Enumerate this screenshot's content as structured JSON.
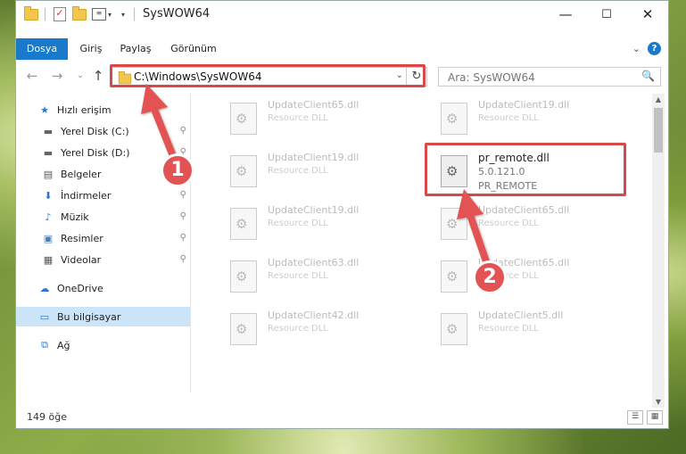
{
  "window": {
    "title": "SysWOW64",
    "minimize": "—",
    "maximize": "☐",
    "close": "✕"
  },
  "ribbon": {
    "tabs": [
      "Dosya",
      "Giriş",
      "Paylaş",
      "Görünüm"
    ],
    "expand": "⌄",
    "help": "?"
  },
  "address": {
    "path": "C:\\Windows\\SysWOW64",
    "refresh": "↻",
    "dropdown": "⌄"
  },
  "search": {
    "placeholder": "Ara: SysWOW64",
    "icon": "🔍"
  },
  "nav_buttons": {
    "back": "←",
    "forward": "→",
    "recent": "⌄",
    "up": "↑"
  },
  "sidebar": {
    "items": [
      {
        "label": "Hızlı erişim",
        "icon": "star-icon",
        "glyph": "★",
        "color": "#2a78d6",
        "pinned": false
      },
      {
        "label": "Yerel Disk (C:)",
        "icon": "drive-icon",
        "glyph": "▬",
        "color": "#666",
        "pinned": true
      },
      {
        "label": "Yerel Disk (D:)",
        "icon": "drive-icon",
        "glyph": "▬",
        "color": "#666",
        "pinned": true
      },
      {
        "label": "Belgeler",
        "icon": "documents-icon",
        "glyph": "▤",
        "color": "#555",
        "pinned": true
      },
      {
        "label": "İndirmeler",
        "icon": "download-icon",
        "glyph": "⬇",
        "color": "#2a78d6",
        "pinned": true
      },
      {
        "label": "Müzik",
        "icon": "music-icon",
        "glyph": "♪",
        "color": "#2a78d6",
        "pinned": true
      },
      {
        "label": "Resimler",
        "icon": "pictures-icon",
        "glyph": "▣",
        "color": "#4a7fb5",
        "pinned": true
      },
      {
        "label": "Videolar",
        "icon": "video-icon",
        "glyph": "▦",
        "color": "#555",
        "pinned": true
      },
      {
        "label": "OneDrive",
        "icon": "cloud-icon",
        "glyph": "☁",
        "color": "#2a78d6",
        "pinned": false
      },
      {
        "label": "Bu bilgisayar",
        "icon": "computer-icon",
        "glyph": "▭",
        "color": "#2a78d6",
        "pinned": false
      },
      {
        "label": "Ağ",
        "icon": "network-icon",
        "glyph": "⧉",
        "color": "#2a78d6",
        "pinned": false
      }
    ],
    "pin_glyph": "📌"
  },
  "files": [
    {
      "name": "UpdateClient65.dll",
      "type": "Resource DLL"
    },
    {
      "name": "UpdateClient19.dll",
      "type": "Resource DLL"
    },
    {
      "name": "UpdateClient19.dll",
      "type": "Resource DLL"
    },
    {
      "name": "pr_remote.dll",
      "type": "5.0.121.0",
      "extra": "PR_REMOTE",
      "highlighted": true
    },
    {
      "name": "UpdateClient19.dll",
      "type": "Resource DLL"
    },
    {
      "name": "UpdateClient65.dll",
      "type": "Resource DLL"
    },
    {
      "name": "UpdateClient63.dll",
      "type": "Resource DLL"
    },
    {
      "name": "UpdateClient65.dll",
      "type": "Resource DLL"
    },
    {
      "name": "UpdateClient42.dll",
      "type": "Resource DLL"
    },
    {
      "name": "UpdateClient5.dll",
      "type": "Resource DLL"
    }
  ],
  "status": {
    "count": "149 öğe"
  },
  "annotations": {
    "step1": "1",
    "step2": "2",
    "color": "#e35353"
  }
}
